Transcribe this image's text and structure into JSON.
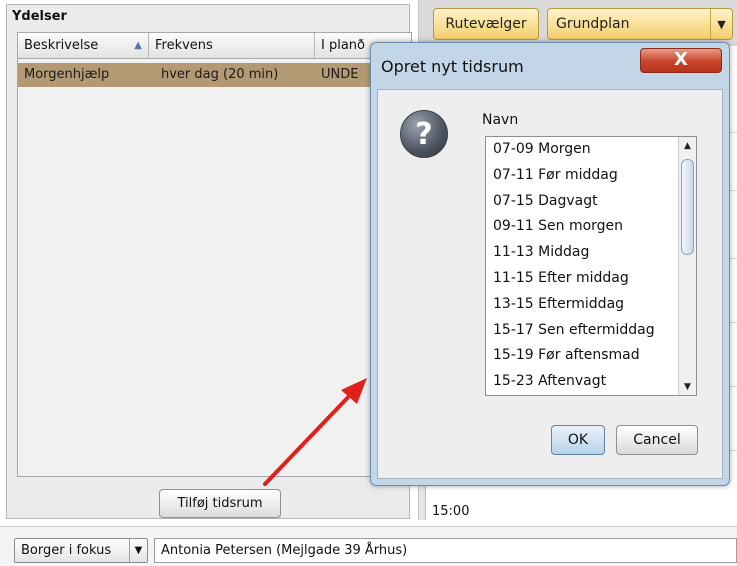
{
  "left_panel": {
    "title": "Ydelser",
    "columns": [
      "Beskrivelse",
      "Frekvens",
      "I planð"
    ],
    "sort_icon": "sort-ascending-icon",
    "rows": [
      {
        "beskrivelse": "Morgenhjælp",
        "frekvens": "hver dag (20 min)",
        "i_plan": "UNDE"
      }
    ],
    "selected_row_color": "#b39a73",
    "add_button_label": "Tilføj tidsrum"
  },
  "right_panel": {
    "route_button_label": "Rutevælger",
    "plan_select_value": "Grundplan",
    "time_label": "15:00",
    "button_color": "#f3cf6c"
  },
  "bottom_bar": {
    "focus_label": "Borger i fokus",
    "citizen_value": "Antonia Petersen (Mejlgade 39 Århus)"
  },
  "dialog": {
    "title": "Opret nyt tidsrum",
    "close_label": "X",
    "close_color": "#c9432b",
    "icon": "question-icon",
    "name_label": "Navn",
    "items": [
      "07-09 Morgen",
      "07-11 Før middag",
      "07-15 Dagvagt",
      "09-11 Sen morgen",
      "11-13 Middag",
      "11-15 Efter middag",
      "13-15 Eftermiddag",
      "15-17 Sen eftermiddag",
      "15-19 Før aftensmad",
      "15-23 Aftenvagt"
    ],
    "ok_label": "OK",
    "cancel_label": "Cancel"
  },
  "annotation": {
    "arrow_color": "#e0201a"
  }
}
